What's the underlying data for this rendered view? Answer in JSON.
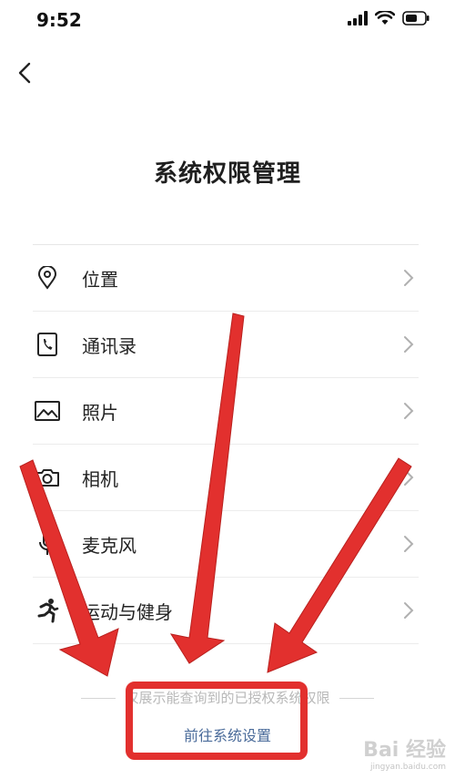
{
  "status_bar": {
    "time": "9:52"
  },
  "page": {
    "title": "系统权限管理"
  },
  "permissions": [
    {
      "label": "位置",
      "icon": "location-pin-icon"
    },
    {
      "label": "通讯录",
      "icon": "phone-contacts-icon"
    },
    {
      "label": "照片",
      "icon": "photo-icon"
    },
    {
      "label": "相机",
      "icon": "camera-icon"
    },
    {
      "label": "麦克风",
      "icon": "microphone-icon"
    },
    {
      "label": "运动与健身",
      "icon": "running-person-icon"
    }
  ],
  "footer": {
    "note": "仅展示能查询到的已授权系统权限",
    "settings_link": "前往系统设置"
  },
  "watermark": {
    "brand": "Bai 经验",
    "site": "jingyan.baidu.com"
  },
  "colors": {
    "annotation_red": "#e2302e",
    "link_blue": "#4a6b9a"
  }
}
